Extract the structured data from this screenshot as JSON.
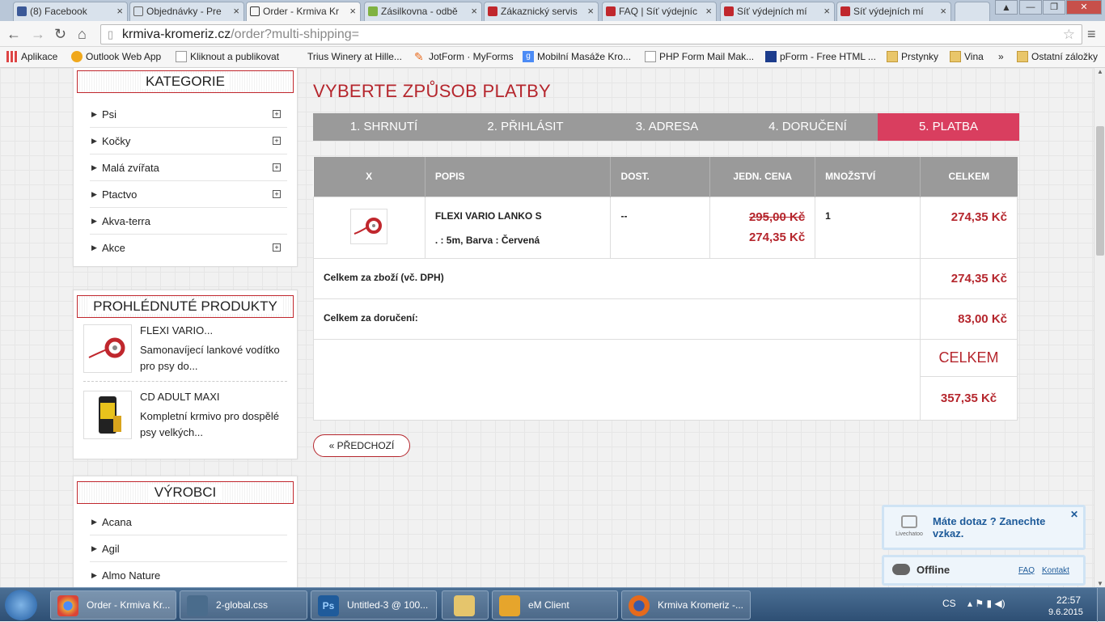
{
  "browser": {
    "tabs": [
      {
        "title": "(8) Facebook",
        "color": "#3b5998"
      },
      {
        "title": "Objednávky - Pre",
        "color": "#666666"
      },
      {
        "title": "Order - Krmiva Kr",
        "color": "#333333"
      },
      {
        "title": "Zásilkovna - odbě",
        "color": "#7fb241"
      },
      {
        "title": "Zákaznický servis",
        "color": "#c0272d"
      },
      {
        "title": "FAQ | Síť výdejníc",
        "color": "#c0272d"
      },
      {
        "title": "Síť výdejních mí",
        "color": "#c0272d"
      },
      {
        "title": "Síť výdejních mí",
        "color": "#c0272d"
      }
    ],
    "url_host": "krmiva-kromeriz.cz",
    "url_path": "/order?multi-shipping=",
    "bookmarks": [
      {
        "label": "Aplikace",
        "icon": "apps-grid-icon"
      },
      {
        "label": "Outlook Web App",
        "icon": "outlook-icon"
      },
      {
        "label": "Kliknout a publikovat",
        "icon": "page-icon"
      },
      {
        "label": "Trius Winery at Hille...",
        "icon": "page-icon"
      },
      {
        "label": "JotForm · MyForms",
        "icon": "jotform-icon"
      },
      {
        "label": "Mobilní Masáže Kro...",
        "icon": "google-icon"
      },
      {
        "label": "PHP Form Mail Mak...",
        "icon": "page-icon"
      },
      {
        "label": "pForm - Free HTML ...",
        "icon": "pform-icon"
      },
      {
        "label": "Prstynky",
        "icon": "folder-icon"
      },
      {
        "label": "Vina",
        "icon": "folder-icon"
      },
      {
        "label": "»",
        "icon": "more-icon"
      },
      {
        "label": "Ostatní záložky",
        "icon": "folder-icon"
      }
    ]
  },
  "sidebar": {
    "categories_title": "KATEGORIE",
    "categories": [
      {
        "label": "Psi",
        "expandable": true
      },
      {
        "label": "Kočky",
        "expandable": true
      },
      {
        "label": "Malá zvířata",
        "expandable": true
      },
      {
        "label": "Ptactvo",
        "expandable": true
      },
      {
        "label": "Akva-terra",
        "expandable": false
      },
      {
        "label": "Akce",
        "expandable": true
      }
    ],
    "viewed_title": "PROHLÉDNUTÉ PRODUKTY",
    "viewed": [
      {
        "name": "FLEXI VARIO...",
        "desc": "Samonavíjecí lankové vodítko pro psy do..."
      },
      {
        "name": "CD ADULT MAXI",
        "desc": "Kompletní krmivo  pro dospělé psy velkých..."
      }
    ],
    "brands_title": "VÝROBCI",
    "brands": [
      "Acana",
      "Agil",
      "Almo Nature"
    ]
  },
  "main": {
    "heading": "VYBERTE ZPŮSOB PLATBY",
    "steps": [
      "1. SHRNUTÍ",
      "2. PŘIHLÁSIT",
      "3. ADRESA",
      "4. DORUČENÍ",
      "5. PLATBA"
    ],
    "active_step": 5,
    "table": {
      "headers": [
        "X",
        "POPIS",
        "DOST.",
        "JEDN. CENA",
        "MNOŽSTVÍ",
        "CELKEM"
      ],
      "item": {
        "name": "FLEXI VARIO LANKO S",
        "attrs": ". : 5m, Barva : Červená",
        "availability": "--",
        "old_price": "295,00 Kč",
        "price": "274,35 Kč",
        "quantity": "1",
        "total": "274,35 Kč"
      },
      "goods_label": "Celkem za zboží (vč. DPH)",
      "goods_value": "274,35 Kč",
      "shipping_label": "Celkem za doručení:",
      "shipping_value": "83,00 Kč",
      "grand_label": "CELKEM",
      "grand_value": "357,35 Kč"
    },
    "prev_button": "« PŘEDCHOZÍ"
  },
  "chat": {
    "message": "Máte dotaz ? Zanechte vzkaz.",
    "brand": "Livechatoo",
    "status": "Offline",
    "faq": "FAQ",
    "contact": "Kontakt"
  },
  "taskbar": {
    "items": [
      {
        "label": "Order - Krmiva Kr...",
        "icon": "chrome-icon",
        "color": "#e8a33a"
      },
      {
        "label": "2-global.css",
        "icon": "editor-icon",
        "color": "#4a6c8c"
      },
      {
        "label": "Untitled-3 @ 100...",
        "icon": "photoshop-icon",
        "color": "#1f5b9b"
      },
      {
        "label": "",
        "icon": "explorer-icon",
        "color": "#e5c56c"
      },
      {
        "label": "eM Client",
        "icon": "emclient-icon",
        "color": "#e6a52c"
      },
      {
        "label": "Krmiva Kromeriz -...",
        "icon": "firefox-icon",
        "color": "#e66a1c"
      }
    ],
    "lang": "CS",
    "time": "22:57",
    "date": "9.6.2015"
  }
}
